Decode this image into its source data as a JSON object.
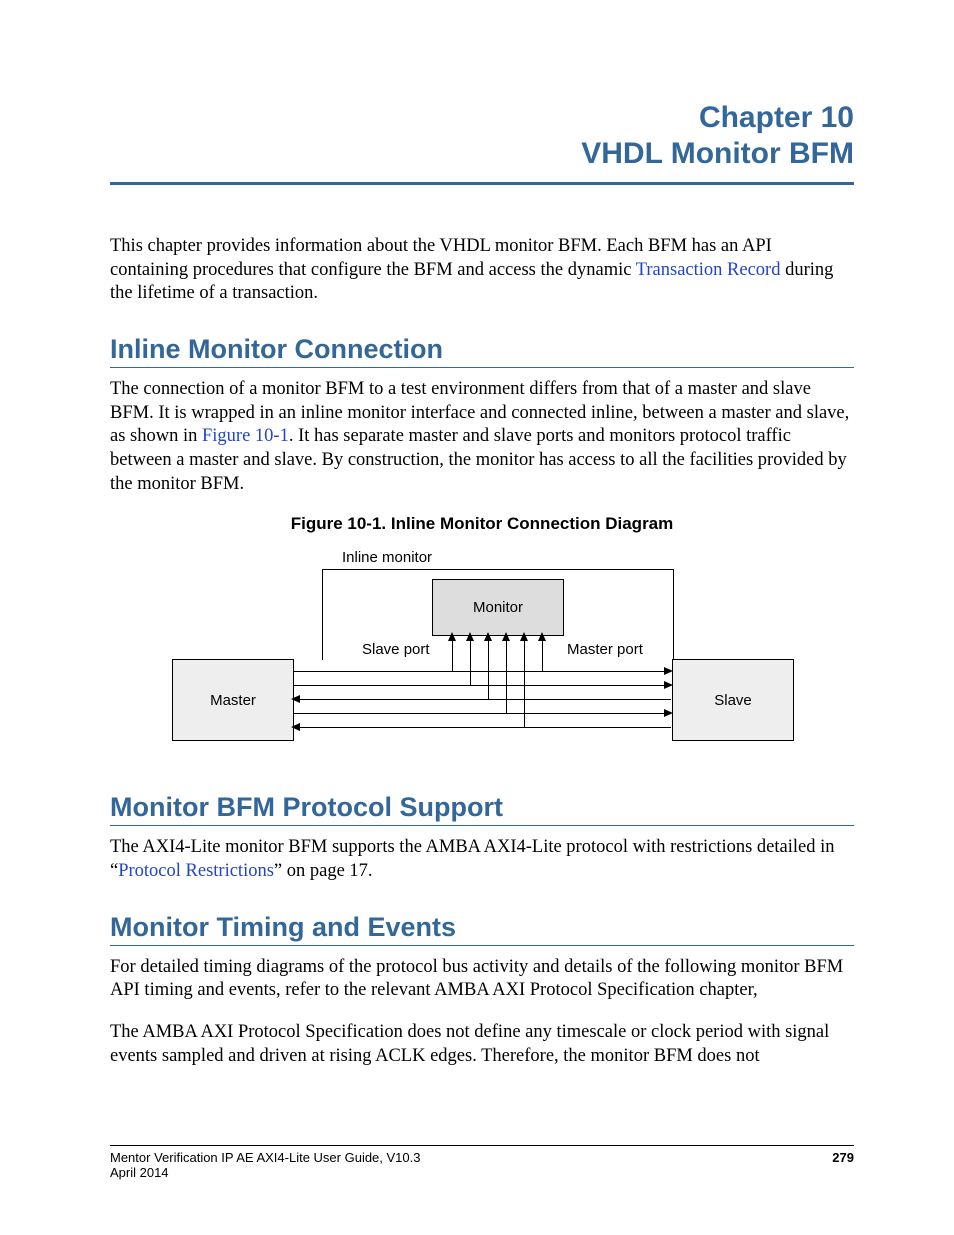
{
  "chapter": {
    "number_line": "Chapter 10",
    "title_line": "VHDL Monitor BFM"
  },
  "intro": {
    "part1": "This chapter provides information about the VHDL monitor BFM. Each BFM has an API containing procedures that configure the BFM and access the dynamic ",
    "link_text": "Transaction Record",
    "part2": " during the lifetime of a transaction."
  },
  "sections": {
    "inline": {
      "heading": "Inline Monitor Connection",
      "para_part1": "The connection of a monitor BFM to a test environment differs from that of a master and slave BFM. It is wrapped in an inline monitor interface and connected inline, between a master and slave, as shown in ",
      "fig_link": "Figure 10-1",
      "para_part2": ". It has separate master and slave ports and monitors protocol traffic between a master and slave. By construction, the monitor has access to all the facilities provided by the monitor BFM.",
      "figure_caption": "Figure 10-1. Inline Monitor Connection Diagram",
      "diagram": {
        "inline_monitor_label": "Inline monitor",
        "monitor_label": "Monitor",
        "slave_port_label": "Slave port",
        "master_port_label": "Master port",
        "master_label": "Master",
        "slave_label": "Slave"
      }
    },
    "protocol": {
      "heading": "Monitor BFM Protocol Support",
      "para_part1": "The AXI4-Lite monitor BFM supports the AMBA AXI4-Lite protocol with restrictions detailed in “",
      "link_text": "Protocol Restrictions",
      "para_part2": "” on page 17."
    },
    "timing": {
      "heading": "Monitor Timing and Events",
      "para1": "For detailed timing diagrams of the protocol bus activity and details of the following monitor BFM API timing and events, refer to the relevant AMBA AXI Protocol Specification chapter,",
      "para2": "The AMBA AXI Protocol Specification does not define any timescale or clock period with signal events sampled and driven at rising ACLK edges. Therefore, the monitor BFM does not"
    }
  },
  "footer": {
    "doc_title": "Mentor Verification IP AE AXI4-Lite User Guide, V10.3",
    "date": "April 2014",
    "page": "279"
  }
}
